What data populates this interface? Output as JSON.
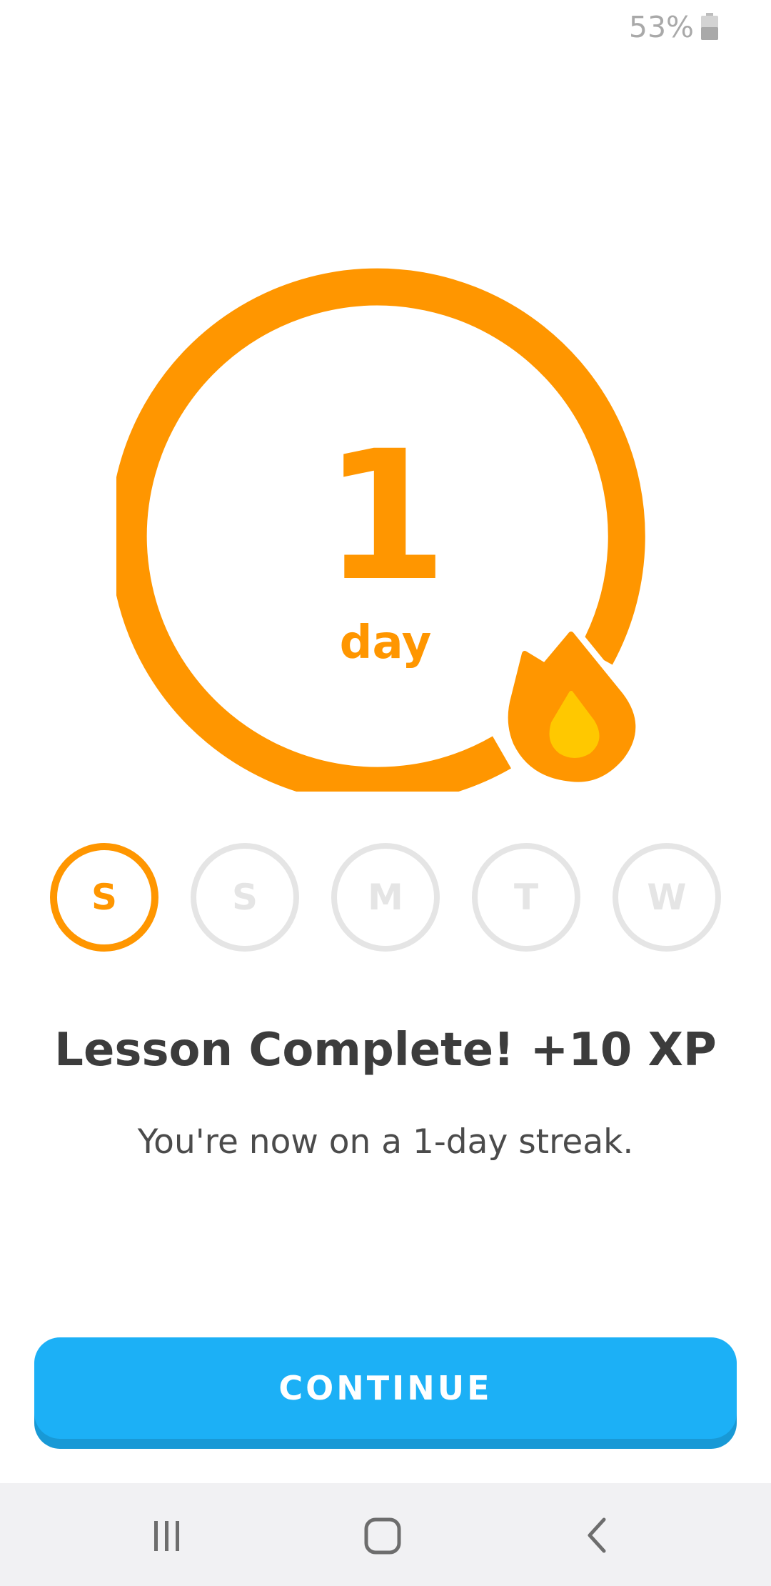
{
  "status_bar": {
    "battery_percent": "53%",
    "icons": [
      "battery-icon"
    ]
  },
  "streak": {
    "count": "1",
    "unit": "day",
    "icon": "flame-icon"
  },
  "week": {
    "days": [
      {
        "label": "S",
        "completed": true
      },
      {
        "label": "S",
        "completed": false
      },
      {
        "label": "M",
        "completed": false
      },
      {
        "label": "T",
        "completed": false
      },
      {
        "label": "W",
        "completed": false
      }
    ]
  },
  "message": {
    "title": "Lesson Complete! +10 XP",
    "subtitle": "You're now on a 1-day streak."
  },
  "actions": {
    "continue_label": "CONTINUE"
  },
  "nav_bar": {
    "icons": [
      "recent-apps-icon",
      "home-icon",
      "back-icon"
    ]
  },
  "colors": {
    "streak_orange": "#ff9600",
    "flame_yellow": "#ffc800",
    "inactive_gray": "#e5e5e5",
    "button_blue": "#1cb0f6",
    "button_shadow": "#1899d6",
    "title_text": "#3c3c3c",
    "nav_background": "#f1f1f3"
  }
}
